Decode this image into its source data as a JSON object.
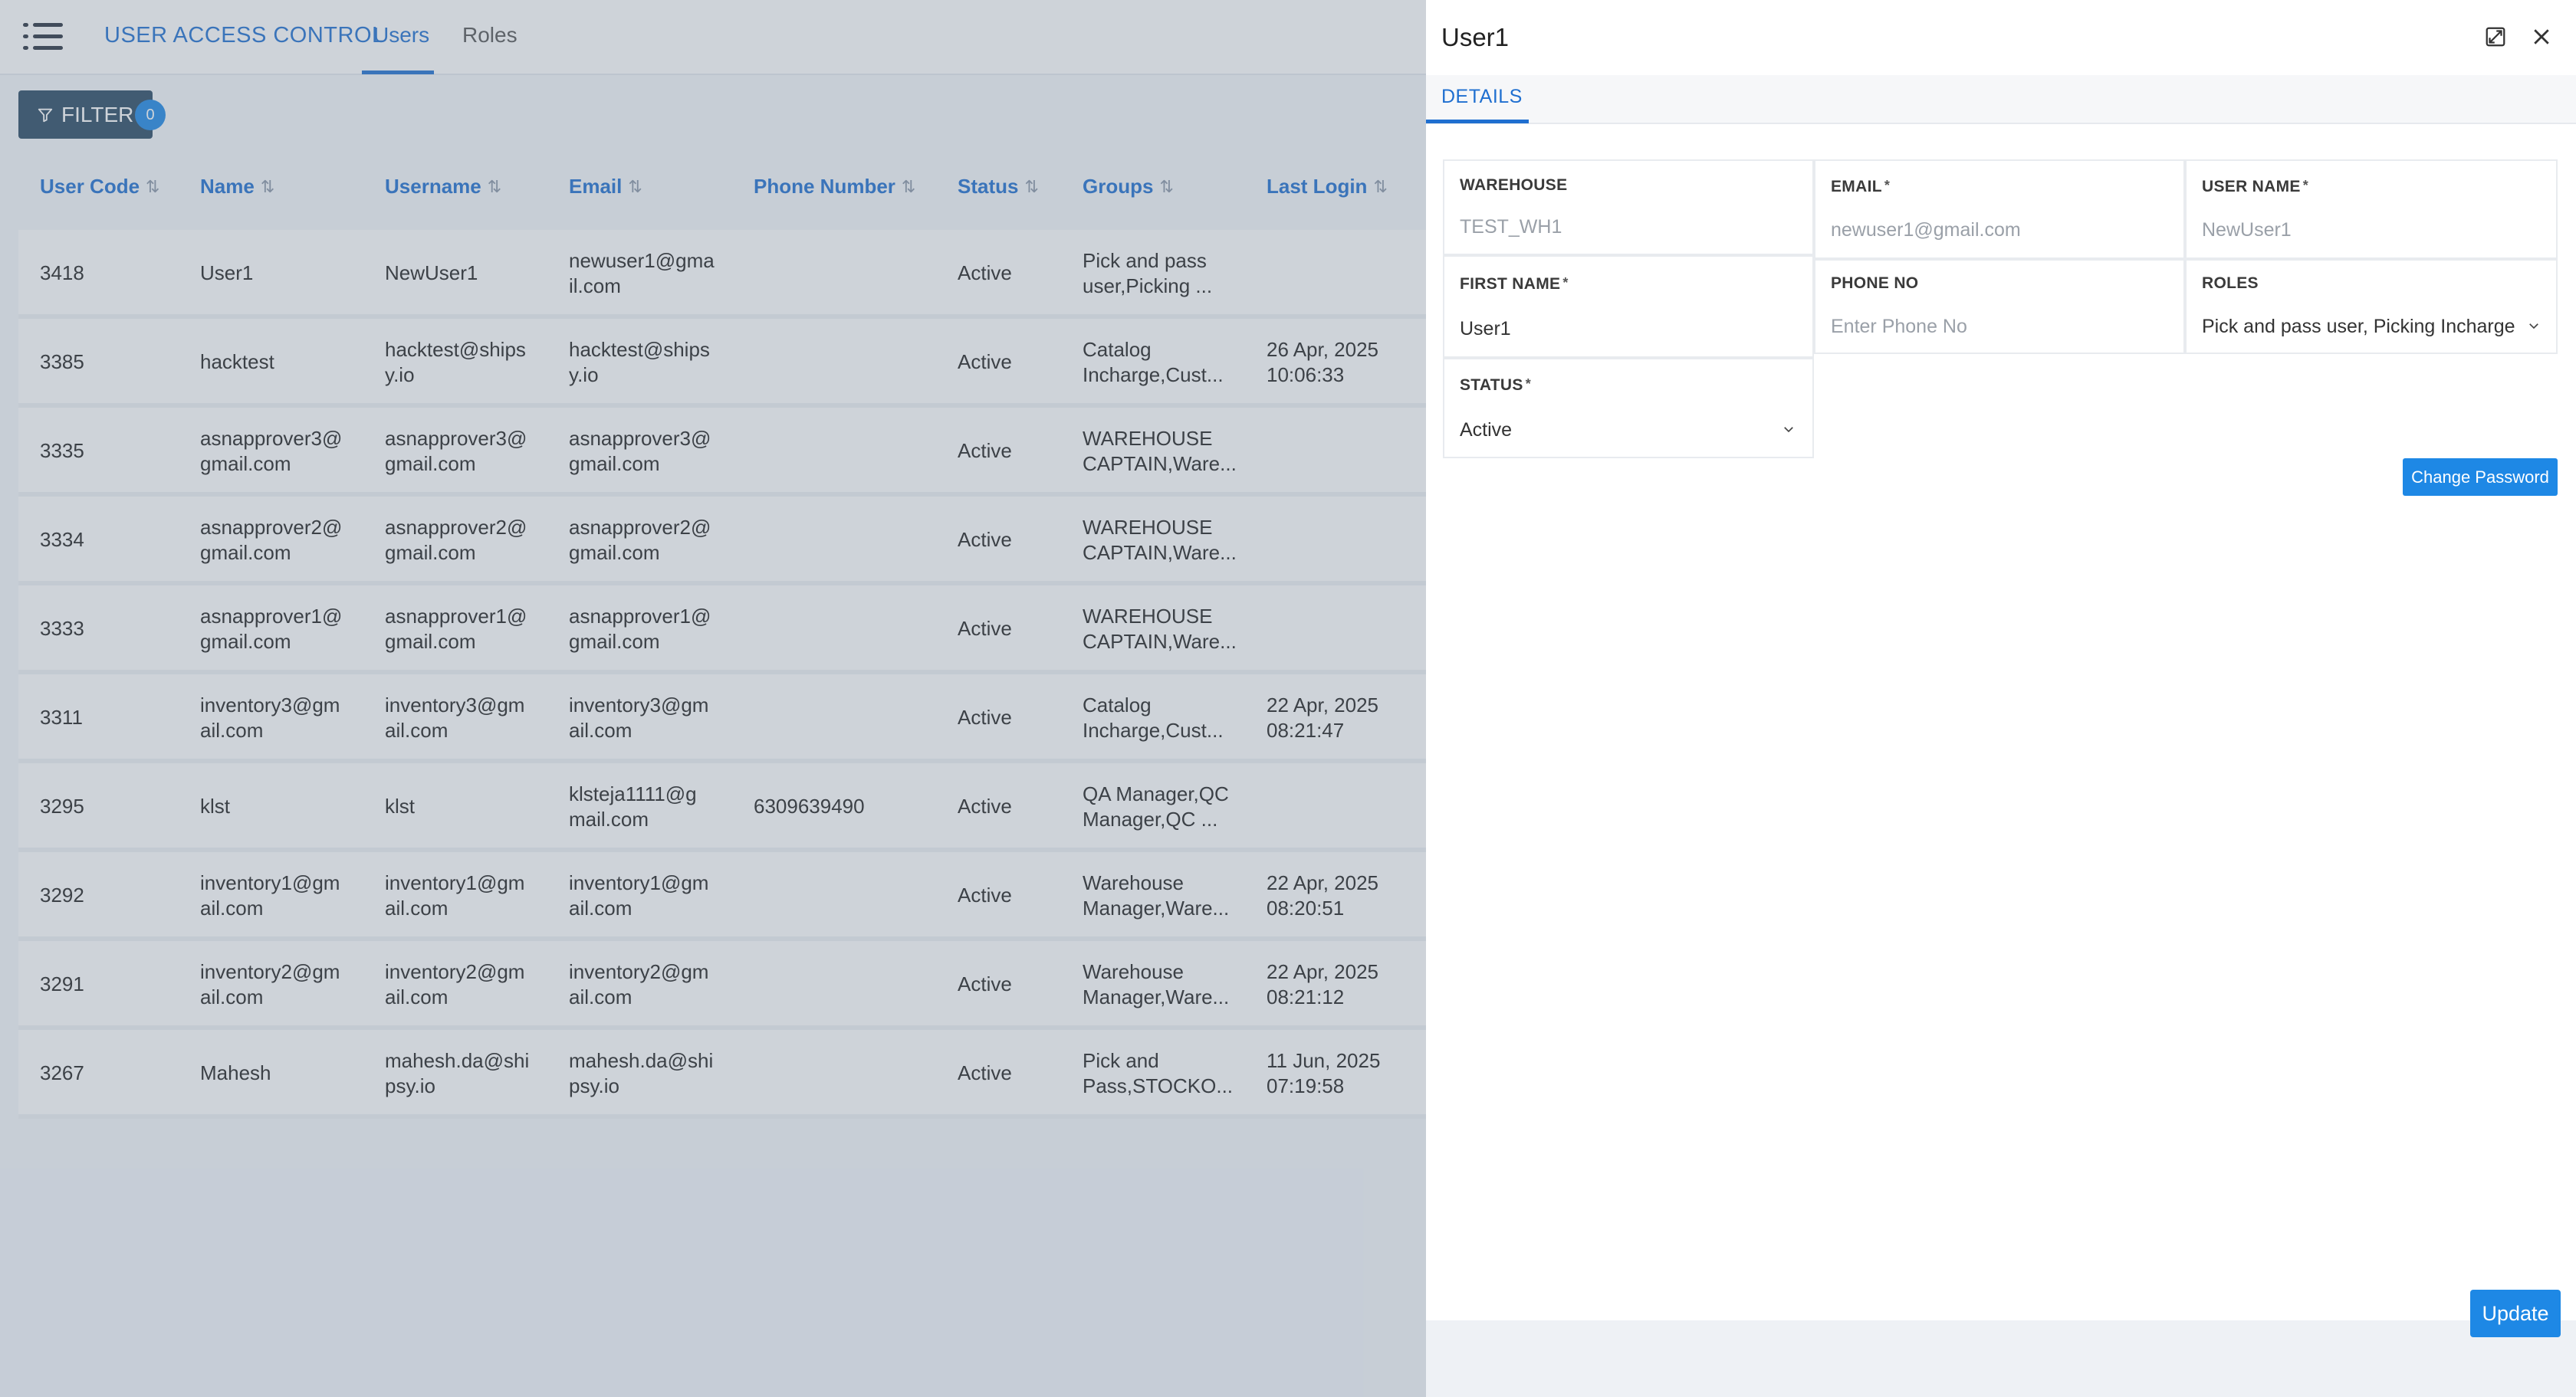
{
  "header": {
    "title": "USER ACCESS CONTROL",
    "tabs": [
      {
        "label": "Users"
      },
      {
        "label": "Roles"
      }
    ]
  },
  "filter": {
    "label": "FILTER",
    "count": "0"
  },
  "table": {
    "columns": [
      "User Code",
      "Name",
      "Username",
      "Email",
      "Phone Number",
      "Status",
      "Groups",
      "Last Login"
    ],
    "rows": [
      {
        "code": "3418",
        "name": [
          "User1"
        ],
        "username": [
          "NewUser1"
        ],
        "email": [
          "newuser1@gma",
          "il.com"
        ],
        "phone": "",
        "status": "Active",
        "groups": [
          "Pick and pass",
          "user,Picking ..."
        ],
        "last_login": []
      },
      {
        "code": "3385",
        "name": [
          "hacktest"
        ],
        "username": [
          "hacktest@ships",
          "y.io"
        ],
        "email": [
          "hacktest@ships",
          "y.io"
        ],
        "phone": "",
        "status": "Active",
        "groups": [
          "Catalog",
          "Incharge,Cust..."
        ],
        "last_login": [
          "26 Apr, 2025",
          "10:06:33"
        ]
      },
      {
        "code": "3335",
        "name": [
          "asnapprover3@",
          "gmail.com"
        ],
        "username": [
          "asnapprover3@",
          "gmail.com"
        ],
        "email": [
          "asnapprover3@",
          "gmail.com"
        ],
        "phone": "",
        "status": "Active",
        "groups": [
          "WAREHOUSE",
          "CAPTAIN,Ware..."
        ],
        "last_login": []
      },
      {
        "code": "3334",
        "name": [
          "asnapprover2@",
          "gmail.com"
        ],
        "username": [
          "asnapprover2@",
          "gmail.com"
        ],
        "email": [
          "asnapprover2@",
          "gmail.com"
        ],
        "phone": "",
        "status": "Active",
        "groups": [
          "WAREHOUSE",
          "CAPTAIN,Ware..."
        ],
        "last_login": []
      },
      {
        "code": "3333",
        "name": [
          "asnapprover1@",
          "gmail.com"
        ],
        "username": [
          "asnapprover1@",
          "gmail.com"
        ],
        "email": [
          "asnapprover1@",
          "gmail.com"
        ],
        "phone": "",
        "status": "Active",
        "groups": [
          "WAREHOUSE",
          "CAPTAIN,Ware..."
        ],
        "last_login": []
      },
      {
        "code": "3311",
        "name": [
          "inventory3@gm",
          "ail.com"
        ],
        "username": [
          "inventory3@gm",
          "ail.com"
        ],
        "email": [
          "inventory3@gm",
          "ail.com"
        ],
        "phone": "",
        "status": "Active",
        "groups": [
          "Catalog",
          "Incharge,Cust..."
        ],
        "last_login": [
          "22 Apr, 2025",
          "08:21:47"
        ]
      },
      {
        "code": "3295",
        "name": [
          "klst"
        ],
        "username": [
          "klst"
        ],
        "email": [
          "klsteja1111@g",
          "mail.com"
        ],
        "phone": "6309639490",
        "status": "Active",
        "groups": [
          "QA Manager,QC",
          "Manager,QC ..."
        ],
        "last_login": []
      },
      {
        "code": "3292",
        "name": [
          "inventory1@gm",
          "ail.com"
        ],
        "username": [
          "inventory1@gm",
          "ail.com"
        ],
        "email": [
          "inventory1@gm",
          "ail.com"
        ],
        "phone": "",
        "status": "Active",
        "groups": [
          "Warehouse",
          "Manager,Ware..."
        ],
        "last_login": [
          "22 Apr, 2025",
          "08:20:51"
        ]
      },
      {
        "code": "3291",
        "name": [
          "inventory2@gm",
          "ail.com"
        ],
        "username": [
          "inventory2@gm",
          "ail.com"
        ],
        "email": [
          "inventory2@gm",
          "ail.com"
        ],
        "phone": "",
        "status": "Active",
        "groups": [
          "Warehouse",
          "Manager,Ware..."
        ],
        "last_login": [
          "22 Apr, 2025",
          "08:21:12"
        ]
      },
      {
        "code": "3267",
        "name": [
          "Mahesh"
        ],
        "username": [
          "mahesh.da@shi",
          "psy.io"
        ],
        "email": [
          "mahesh.da@shi",
          "psy.io"
        ],
        "phone": "",
        "status": "Active",
        "groups": [
          "Pick and",
          "Pass,STOCKO..."
        ],
        "last_login": [
          "11 Jun, 2025",
          "07:19:58"
        ]
      }
    ]
  },
  "drawer": {
    "title": "User1",
    "tab": "DETAILS",
    "fields": {
      "warehouse": {
        "label": "WAREHOUSE",
        "value": "TEST_WH1"
      },
      "email": {
        "label": "EMAIL",
        "required": "*",
        "value": "newuser1@gmail.com"
      },
      "user_name": {
        "label": "USER NAME",
        "required": "*",
        "value": "NewUser1"
      },
      "first_name": {
        "label": "FIRST NAME",
        "required": "*",
        "value": "User1"
      },
      "phone_no": {
        "label": "PHONE NO",
        "placeholder": "Enter Phone No"
      },
      "roles": {
        "label": "ROLES",
        "value": "Pick and pass user, Picking Incharge,"
      },
      "status": {
        "label": "STATUS",
        "required": "*",
        "value": "Active"
      }
    },
    "change_password_label": "Change Password",
    "update_label": "Update"
  },
  "colors": {
    "accent": "#1f6fd0",
    "button": "#1e88e5",
    "filter_bg": "#2a4a63"
  }
}
